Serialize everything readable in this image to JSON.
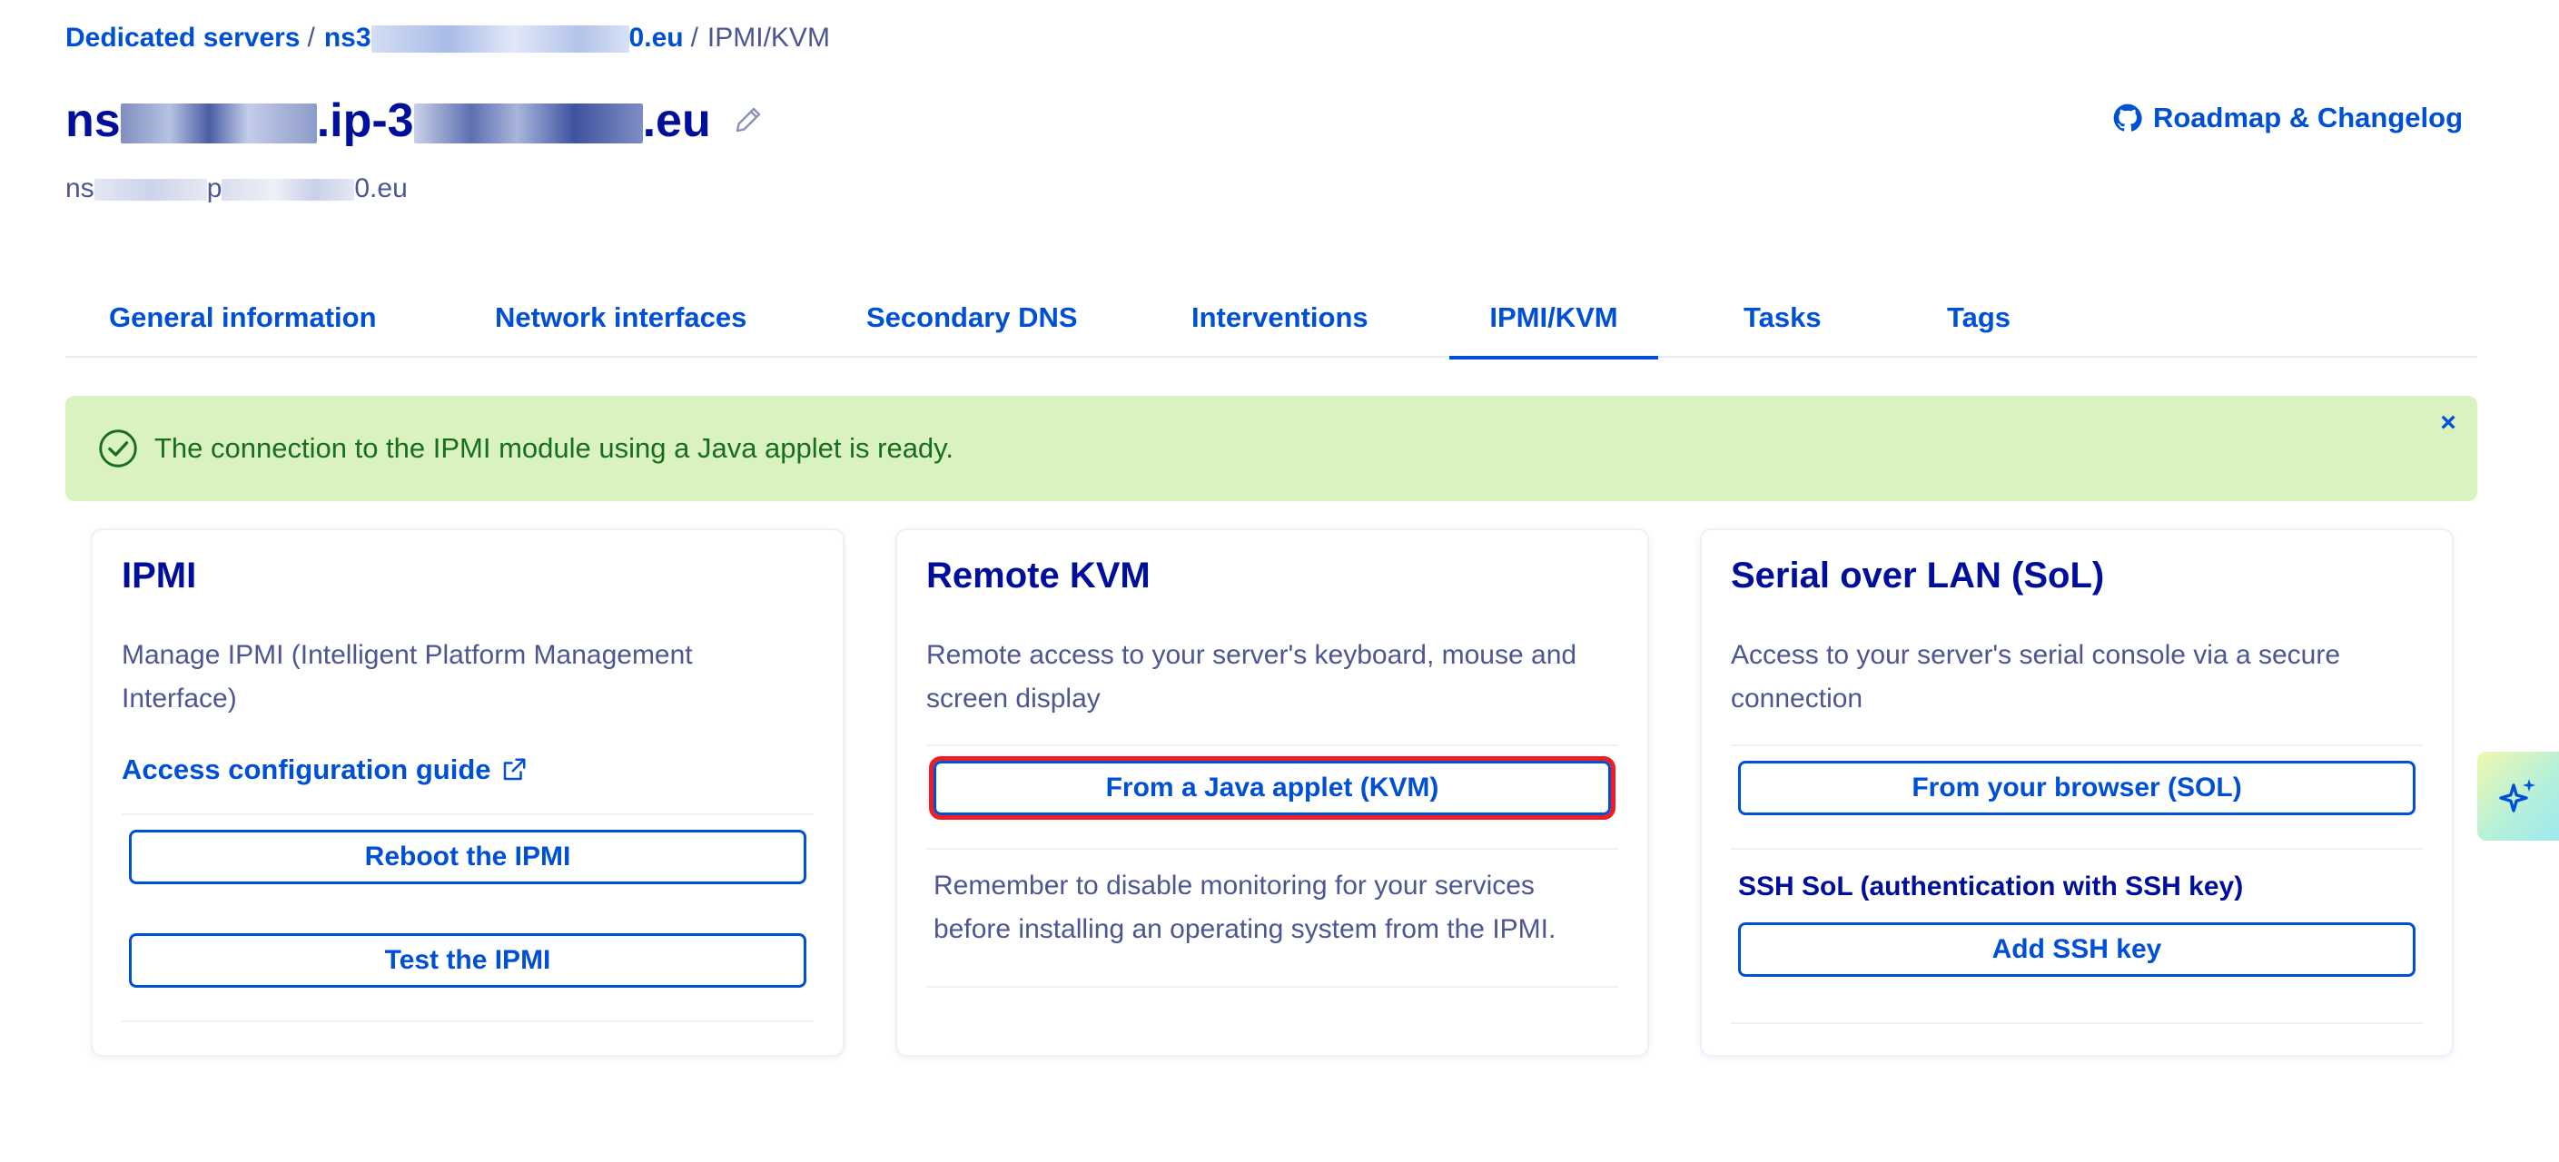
{
  "breadcrumb": {
    "root": "Dedicated servers",
    "server_prefix": "ns3",
    "server_suffix": "0.eu",
    "current": "IPMI/KVM",
    "separator": "/"
  },
  "header": {
    "title_prefix": "ns",
    "title_mid": ".ip-3",
    "title_suffix": ".eu",
    "subtitle_prefix": "ns",
    "subtitle_mid": "p",
    "subtitle_suffix": "0.eu",
    "roadmap_label": "Roadmap & Changelog"
  },
  "tabs": [
    {
      "label": "General information"
    },
    {
      "label": "Network interfaces"
    },
    {
      "label": "Secondary DNS"
    },
    {
      "label": "Interventions"
    },
    {
      "label": "IPMI/KVM"
    },
    {
      "label": "Tasks"
    },
    {
      "label": "Tags"
    }
  ],
  "alert": {
    "message": "The connection to the IPMI module using a Java applet is ready.",
    "close_label": "×"
  },
  "cards": {
    "ipmi": {
      "title": "IPMI",
      "description": "Manage IPMI (Intelligent Platform Management Interface)",
      "guide_link": "Access configuration guide",
      "reboot_button": "Reboot the IPMI",
      "test_button": "Test the IPMI"
    },
    "kvm": {
      "title": "Remote KVM",
      "description": "Remote access to your server's keyboard, mouse and screen display",
      "java_button": "From a Java applet (KVM)",
      "note": "Remember to disable monitoring for your services before installing an operating system from the IPMI."
    },
    "sol": {
      "title": "Serial over LAN (SoL)",
      "description": "Access to your server's serial console via a secure connection",
      "browser_button": "From your browser (SOL)",
      "ssh_label": "SSH SoL (authentication with SSH key)",
      "add_ssh_button": "Add SSH key"
    }
  },
  "colors": {
    "primary": "#0050d7",
    "heading": "#000e9c",
    "text": "#4d5592",
    "success_bg": "#d9f2bf",
    "success_text": "#196e1e",
    "highlight": "#ee1c25"
  },
  "icons": {
    "edit": "pencil-icon",
    "github": "github-icon",
    "success": "check-circle-icon",
    "close": "close-icon",
    "external": "external-link-icon",
    "assistant": "sparkle-icon"
  }
}
